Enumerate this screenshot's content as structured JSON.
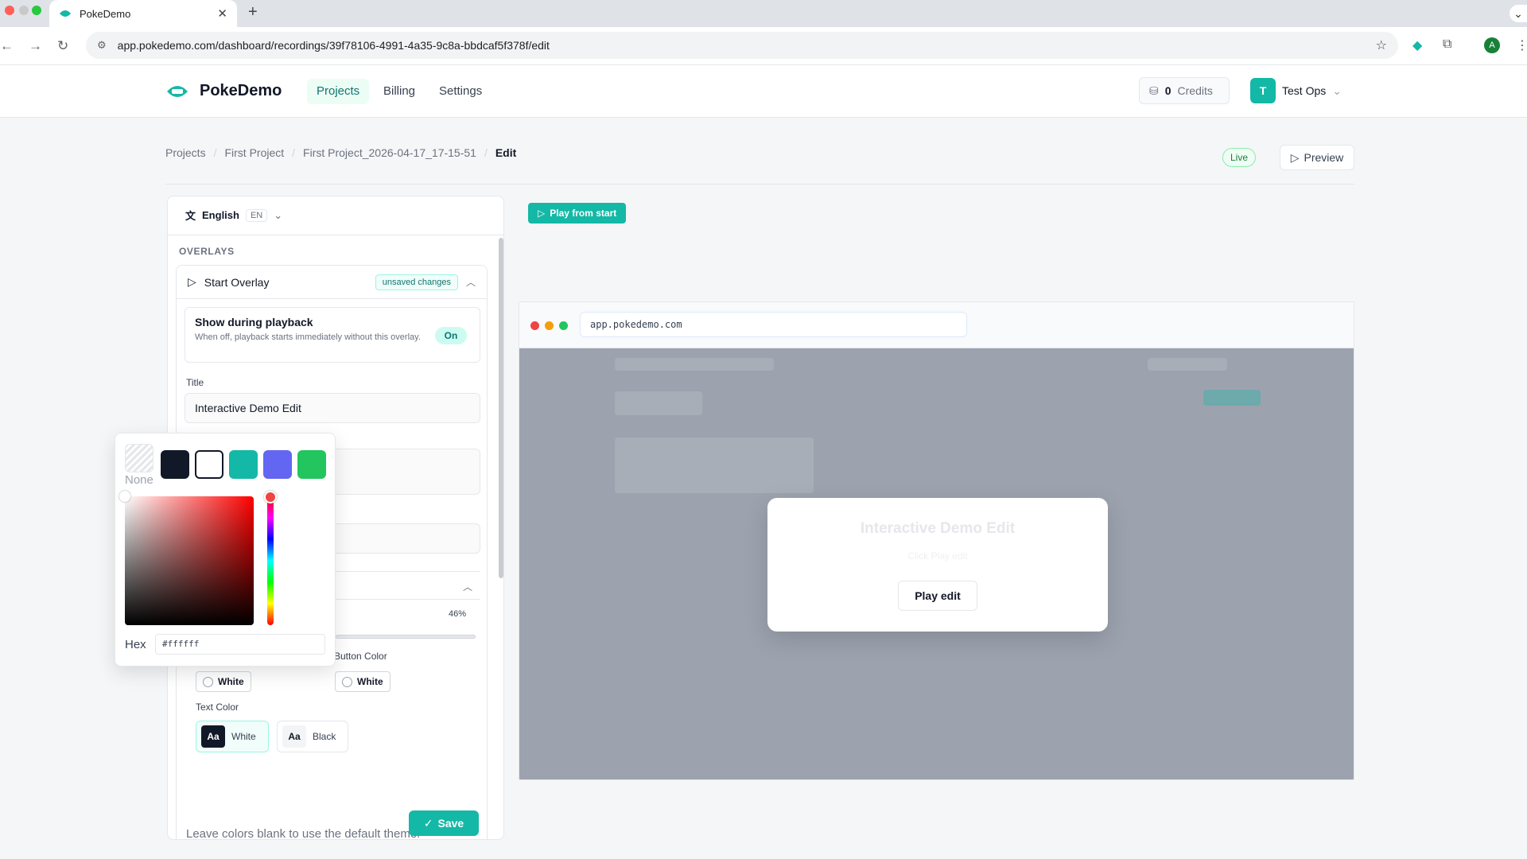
{
  "browser": {
    "tab_title": "PokeDemo",
    "url": "app.pokedemo.com/dashboard/recordings/39f78106-4991-4a35-9c8a-bbdcaf5f378f/edit",
    "profile_initial": "A"
  },
  "header": {
    "brand": "PokeDemo",
    "nav": [
      "Projects",
      "Billing",
      "Settings"
    ],
    "credits_count": "0",
    "credits_label": "Credits",
    "user_initial": "T",
    "user_name": "Test Ops"
  },
  "breadcrumb": [
    "Projects",
    "First Project",
    "First Project_2026-04-17_17-15-51",
    "Edit"
  ],
  "status_badge": "Live",
  "preview_label": "Preview",
  "language": {
    "name": "English",
    "code": "EN"
  },
  "overlays": {
    "section_label": "OVERLAYS",
    "start_overlay": {
      "title": "Start Overlay",
      "badge": "unsaved changes",
      "show_playback_title": "Show during playback",
      "show_playback_desc": "When off, playback starts immediately without this overlay.",
      "show_playback_state": "On",
      "title_label": "Title",
      "title_value": "Interactive Demo Edit",
      "opacity_value": "46%",
      "background_color": "White",
      "button_color_label": "Button Color",
      "button_color": "White",
      "text_color_label": "Text Color",
      "text_color_options": [
        {
          "sample": "Aa",
          "label": "White"
        },
        {
          "sample": "Aa",
          "label": "Black"
        }
      ],
      "hint": "Leave colors blank to use the default theme.",
      "save_label": "Save"
    }
  },
  "color_picker": {
    "none_label": "None",
    "swatches": [
      "#111827",
      "#ffffff",
      "#14b8a6",
      "#6366f1",
      "#22c55e"
    ],
    "hex_label": "Hex",
    "hex_value": "#ffffff"
  },
  "preview": {
    "play_from_start": "Play from start",
    "frame_url": "app.pokedemo.com",
    "modal_title": "Interactive Demo Edit",
    "modal_subtitle": "Click Play edit",
    "modal_button": "Play edit"
  },
  "colors": {
    "accent": "#14b8a6",
    "live_green": "#15803d"
  }
}
